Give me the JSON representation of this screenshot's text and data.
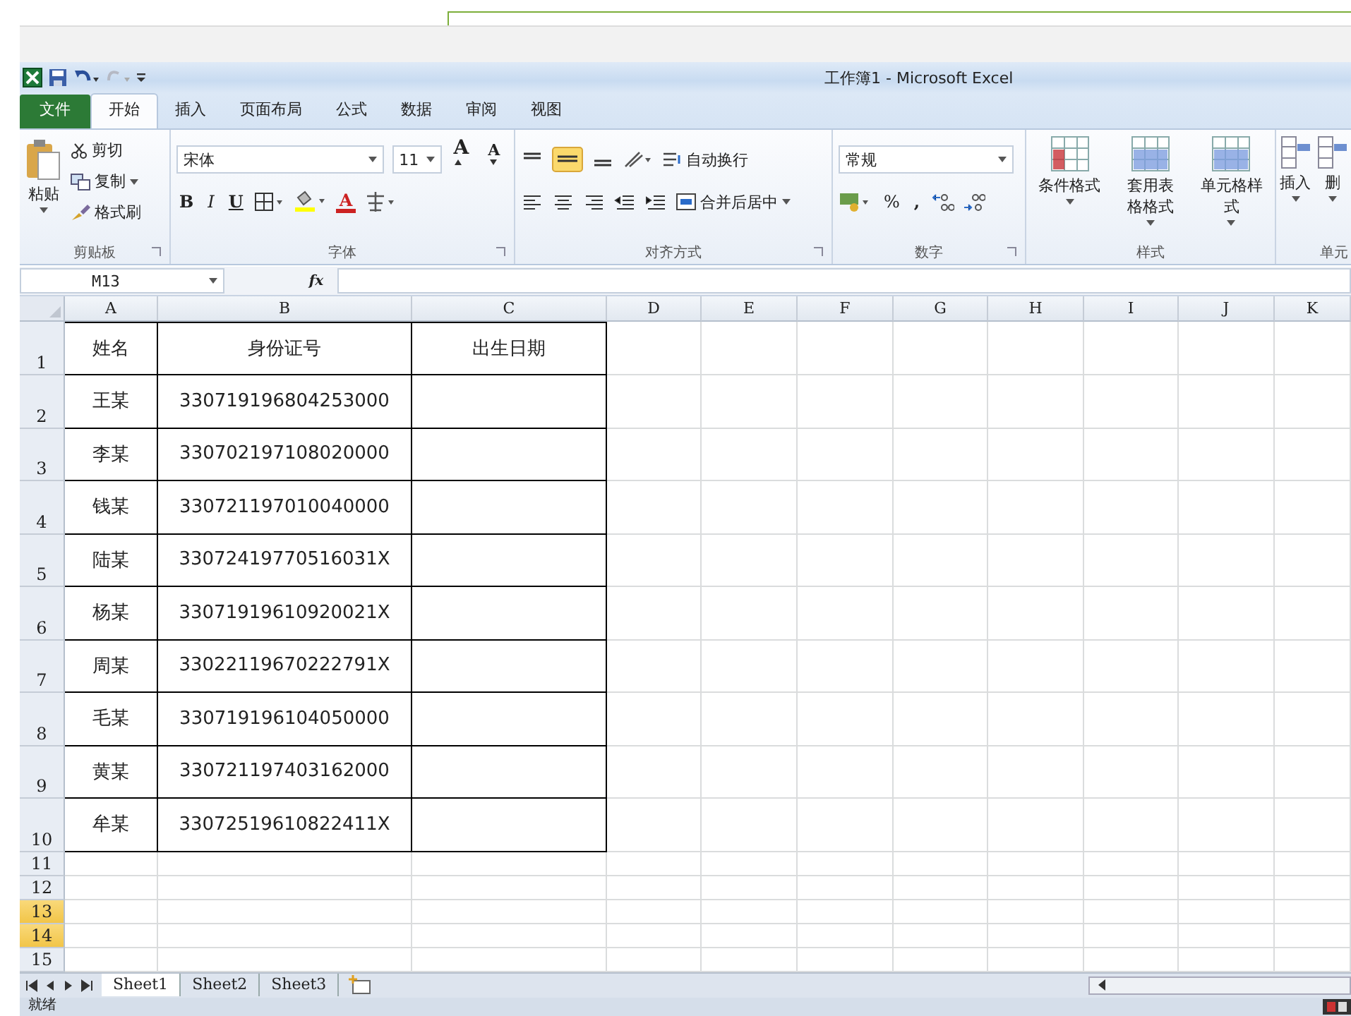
{
  "window": {
    "title": "工作簿1 - Microsoft Excel"
  },
  "tabs": [
    {
      "label": "文件",
      "selected": false,
      "kind": "file"
    },
    {
      "label": "开始",
      "selected": true,
      "kind": "tab"
    },
    {
      "label": "插入",
      "selected": false,
      "kind": "tab"
    },
    {
      "label": "页面布局",
      "selected": false,
      "kind": "tab"
    },
    {
      "label": "公式",
      "selected": false,
      "kind": "tab"
    },
    {
      "label": "数据",
      "selected": false,
      "kind": "tab"
    },
    {
      "label": "审阅",
      "selected": false,
      "kind": "tab"
    },
    {
      "label": "视图",
      "selected": false,
      "kind": "tab"
    }
  ],
  "clipboard": {
    "label": "剪贴板",
    "paste": "粘贴",
    "cut": "剪切",
    "copy": "复制",
    "format_painter": "格式刷"
  },
  "font": {
    "label": "字体",
    "family": "宋体",
    "size": "11",
    "bold": "B",
    "italic": "I",
    "underline": "U",
    "grow": "A",
    "shrink": "A",
    "font_color": "A"
  },
  "alignment": {
    "label": "对齐方式",
    "wrap": "自动换行",
    "merge": "合并后居中"
  },
  "number": {
    "label": "数字",
    "format": "常规",
    "percent": "%",
    "comma": ","
  },
  "styles": {
    "label": "样式",
    "buttons": [
      {
        "label": "条件格式"
      },
      {
        "label": "套用表格格式"
      },
      {
        "label": "单元格样式"
      }
    ]
  },
  "cells_group": {
    "label": "单元",
    "buttons": [
      {
        "label": "插入"
      },
      {
        "label": "删"
      }
    ]
  },
  "formula_bar": {
    "name_box": "M13",
    "fx": "fx"
  },
  "columns": [
    "A",
    "B",
    "C",
    "D",
    "E",
    "F",
    "G",
    "H",
    "I",
    "J",
    "K"
  ],
  "rows": [
    {
      "number": "1",
      "bordered": true,
      "highlighted": false,
      "cells": [
        "姓名",
        "身份证号",
        "出生日期"
      ]
    },
    {
      "number": "2",
      "bordered": true,
      "highlighted": false,
      "cells": [
        "王某",
        "330719196804253000"
      ]
    },
    {
      "number": "3",
      "bordered": true,
      "highlighted": false,
      "cells": [
        "李某",
        "330702197108020000"
      ]
    },
    {
      "number": "4",
      "bordered": true,
      "highlighted": false,
      "cells": [
        "钱某",
        "330721197010040000"
      ]
    },
    {
      "number": "5",
      "bordered": true,
      "highlighted": false,
      "cells": [
        "陆某",
        "33072419770516031X"
      ]
    },
    {
      "number": "6",
      "bordered": true,
      "highlighted": false,
      "cells": [
        "杨某",
        "33071919610920021X"
      ]
    },
    {
      "number": "7",
      "bordered": true,
      "highlighted": false,
      "cells": [
        "周某",
        "33022119670222791X"
      ]
    },
    {
      "number": "8",
      "bordered": true,
      "highlighted": false,
      "cells": [
        "毛某",
        "330719196104050000"
      ]
    },
    {
      "number": "9",
      "bordered": true,
      "highlighted": false,
      "cells": [
        "黄某",
        "330721197403162000"
      ]
    },
    {
      "number": "10",
      "bordered": true,
      "highlighted": false,
      "cells": [
        "牟某",
        "33072519610822411X"
      ]
    },
    {
      "number": "11",
      "bordered": false,
      "highlighted": false,
      "cells": []
    },
    {
      "number": "12",
      "bordered": false,
      "highlighted": false,
      "cells": []
    },
    {
      "number": "13",
      "bordered": false,
      "highlighted": true,
      "cells": []
    },
    {
      "number": "14",
      "bordered": false,
      "highlighted": true,
      "cells": []
    },
    {
      "number": "15",
      "bordered": false,
      "highlighted": false,
      "cells": []
    }
  ],
  "sheet_tabs": [
    {
      "label": "Sheet1",
      "selected": true
    },
    {
      "label": "Sheet2",
      "selected": false
    },
    {
      "label": "Sheet3",
      "selected": false
    }
  ],
  "status_bar": {
    "text": "就绪"
  }
}
